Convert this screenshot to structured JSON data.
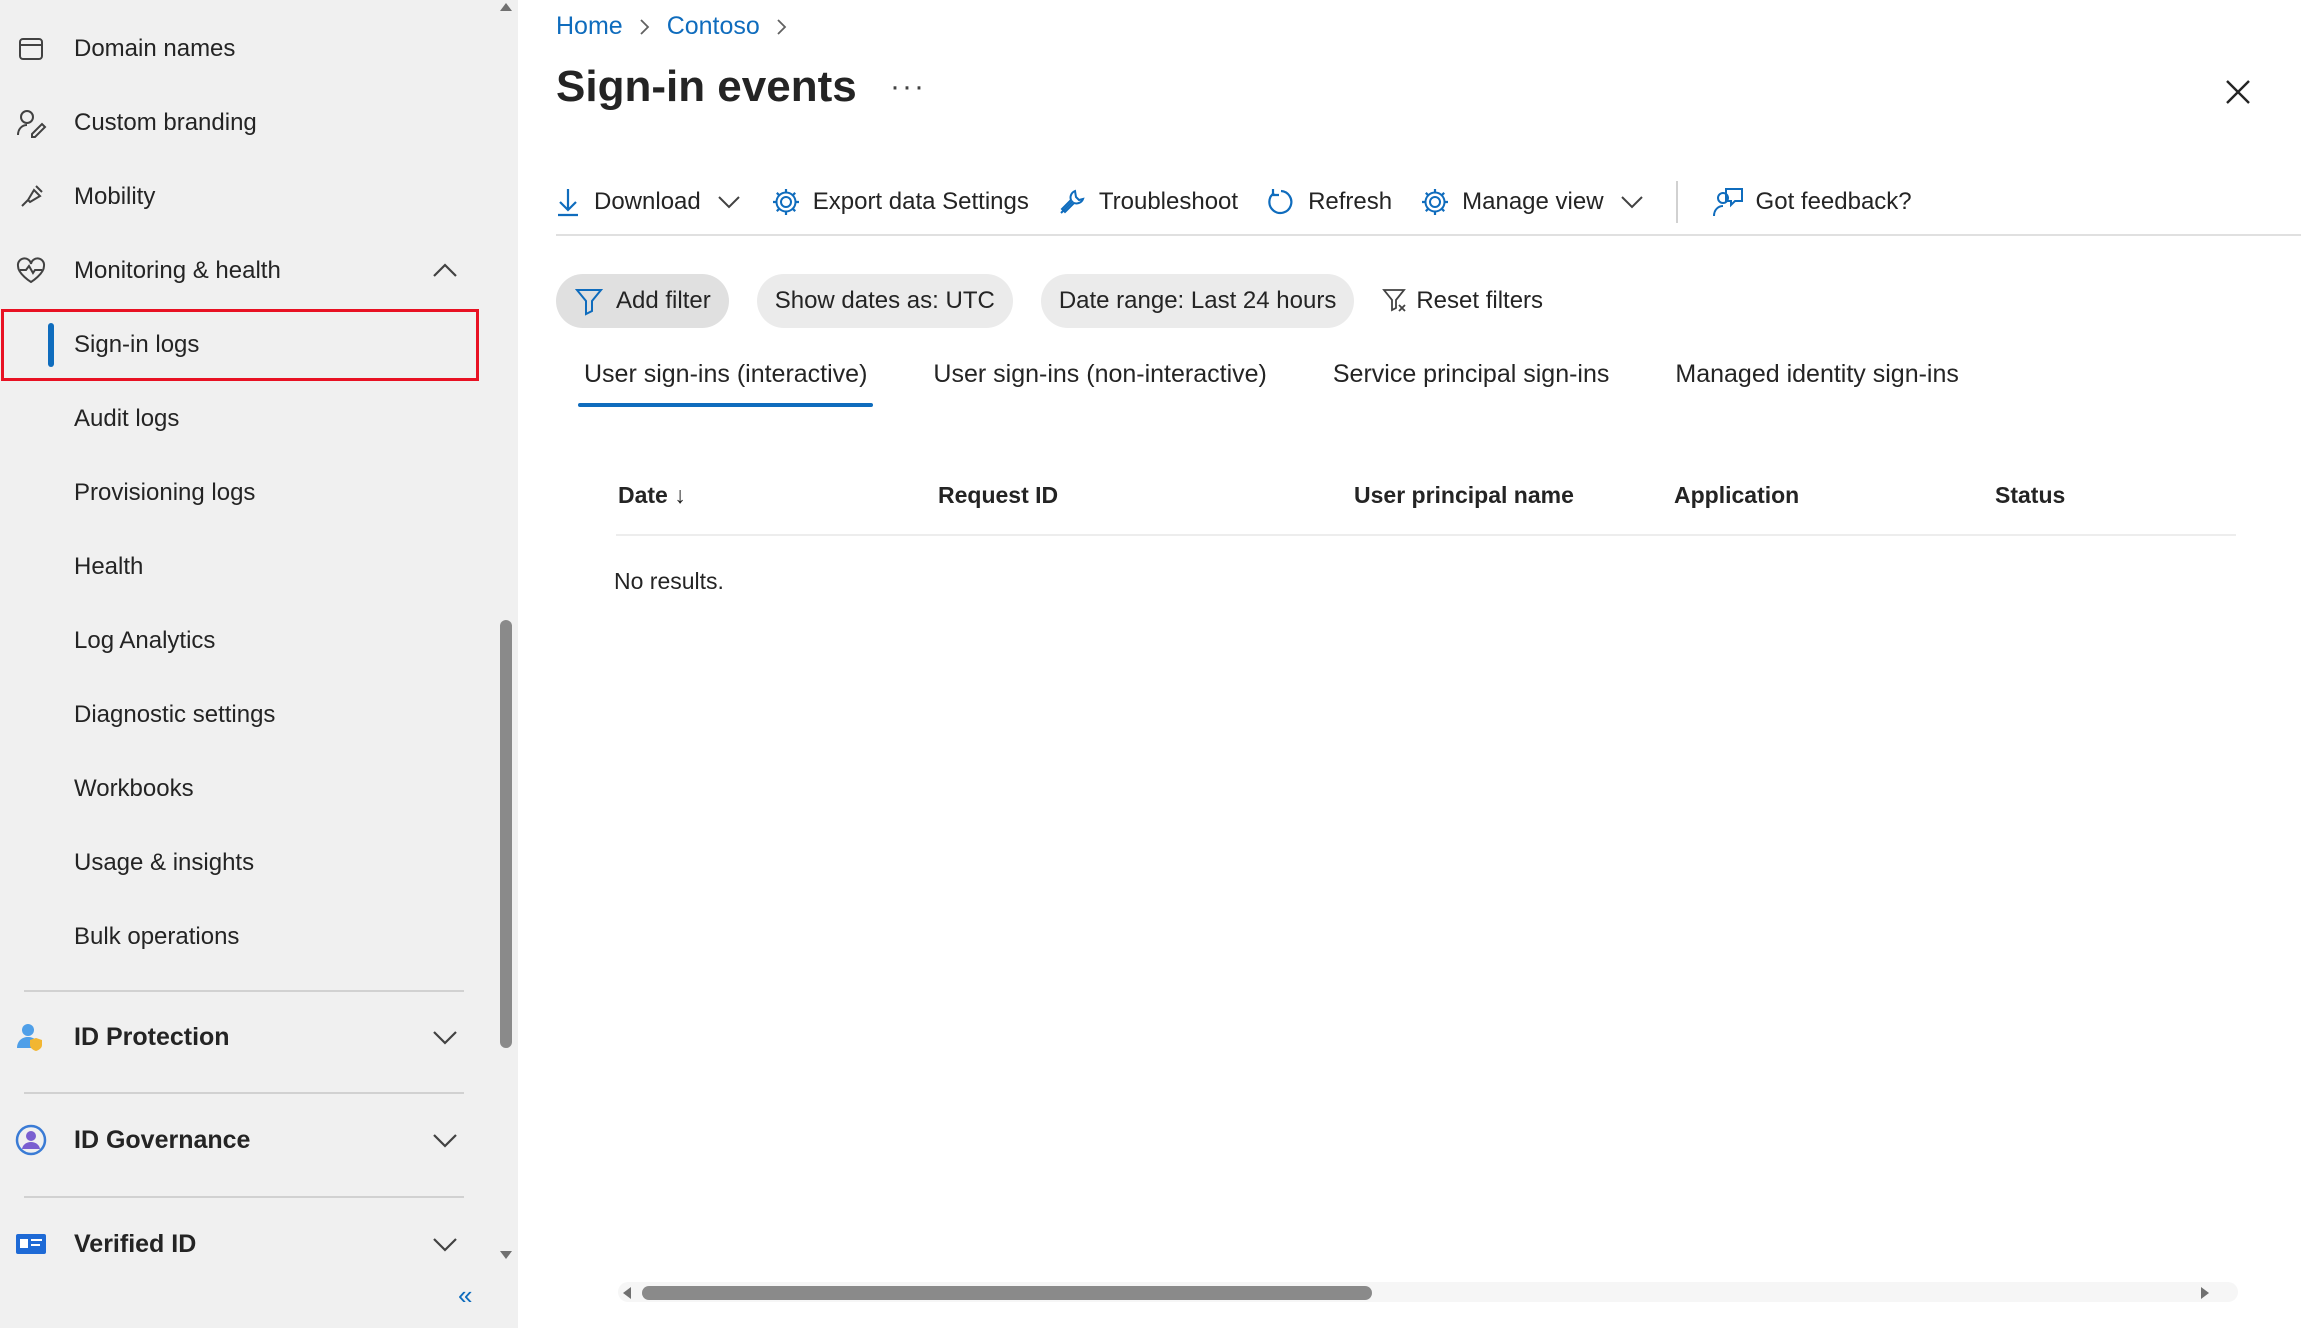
{
  "sidebar": {
    "items": [
      {
        "label": "Domain names",
        "icon": "domain-icon"
      },
      {
        "label": "Custom branding",
        "icon": "branding-icon"
      },
      {
        "label": "Mobility",
        "icon": "mobility-icon"
      },
      {
        "label": "Monitoring & health",
        "icon": "heart-pulse-icon"
      },
      {
        "label": "Sign-in logs"
      },
      {
        "label": "Audit logs"
      },
      {
        "label": "Provisioning logs"
      },
      {
        "label": "Health"
      },
      {
        "label": "Log Analytics"
      },
      {
        "label": "Diagnostic settings"
      },
      {
        "label": "Workbooks"
      },
      {
        "label": "Usage & insights"
      },
      {
        "label": "Bulk operations"
      }
    ],
    "groups": [
      {
        "label": "ID Protection",
        "icon": "id-protection-icon"
      },
      {
        "label": "ID Governance",
        "icon": "id-governance-icon"
      },
      {
        "label": "Verified ID",
        "icon": "verified-id-icon"
      }
    ],
    "collapse_label": "«",
    "selected": "Sign-in logs"
  },
  "breadcrumb": {
    "items": [
      "Home",
      "Contoso"
    ]
  },
  "page": {
    "title": "Sign-in events",
    "more": "···"
  },
  "toolbar": {
    "download": "Download",
    "export": "Export data Settings",
    "troubleshoot": "Troubleshoot",
    "refresh": "Refresh",
    "manage_view": "Manage view",
    "feedback": "Got feedback?"
  },
  "filters": {
    "add_filter": "Add filter",
    "show_dates": "Show dates as: UTC",
    "date_range": "Date range: Last 24 hours",
    "reset": "Reset filters"
  },
  "tabs": [
    {
      "label": "User sign-ins (interactive)",
      "active": true
    },
    {
      "label": "User sign-ins (non-interactive)",
      "active": false
    },
    {
      "label": "Service principal sign-ins",
      "active": false
    },
    {
      "label": "Managed identity sign-ins",
      "active": false
    }
  ],
  "table": {
    "columns": [
      "Date ↓",
      "Request ID",
      "User principal name",
      "Application",
      "Status"
    ],
    "empty_message": "No results."
  },
  "colors": {
    "accent": "#0f6cbd",
    "highlight": "#e81123",
    "sidebar_bg": "#f0f0f0"
  }
}
